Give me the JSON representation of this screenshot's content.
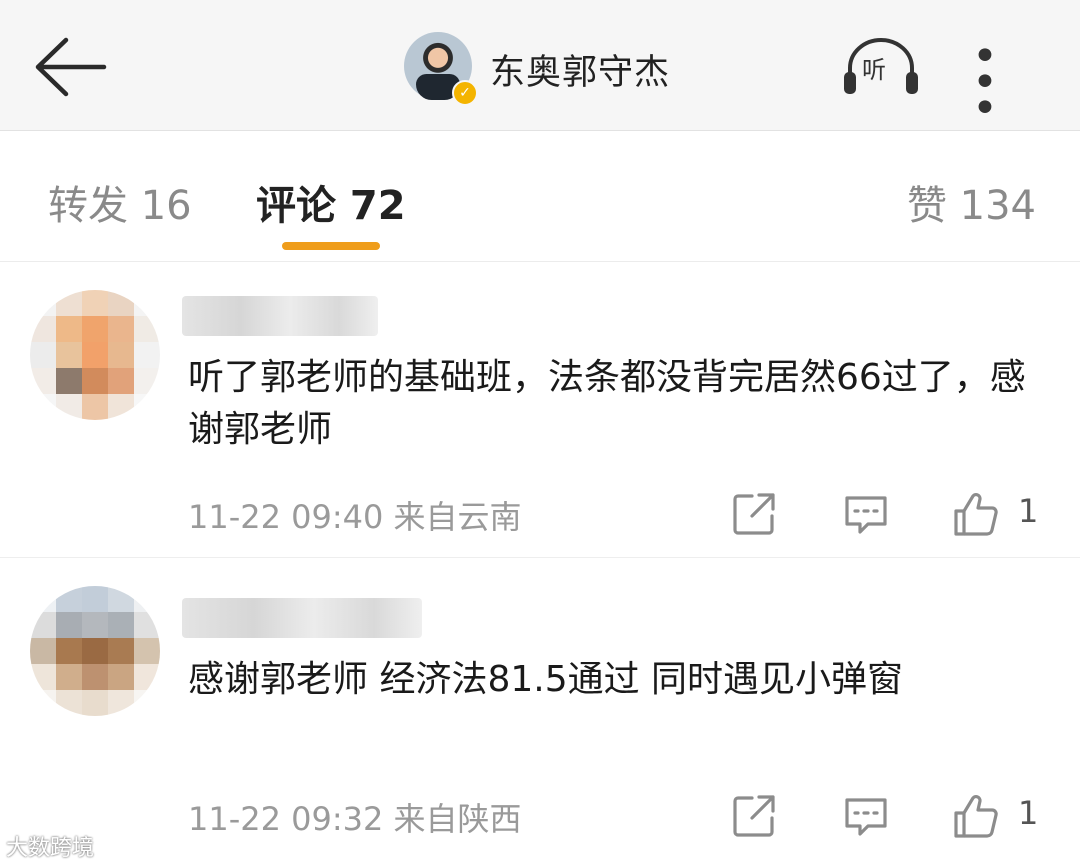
{
  "header": {
    "title": "东奥郭守杰",
    "listen_label": "听",
    "more_label": "• • •"
  },
  "tabs": {
    "repost": "转发 16",
    "comment": "评论 72",
    "like": "赞 134"
  },
  "colors": {
    "accent": "#ef9d1b",
    "verified": "#f4b400"
  },
  "comments": [
    {
      "text": "听了郭老师的基础班，法条都没背完居然66过了，感谢郭老师",
      "meta": "11-22 09:40  来自云南",
      "likes": "1",
      "avatar_colors": [
        "#f3f3f3",
        "#eedfd2",
        "#f0d2b6",
        "#e9d4c2",
        "#f4f4f4",
        "#efe6df",
        "#eeb988",
        "#f0a46c",
        "#eab58d",
        "#f0ebe5",
        "#ececec",
        "#e8c39c",
        "#f2a16a",
        "#e7b88f",
        "#f2f2f2",
        "#f2ece7",
        "#8d7a6c",
        "#d28b5c",
        "#e1a27a",
        "#f3f0ed",
        "#f6f6f6",
        "#f1ebe6",
        "#edc6a6",
        "#f0e4d9",
        "#f7f7f7"
      ]
    },
    {
      "text": "感谢郭老师 经济法81.5通过 同时遇见小弹窗",
      "meta": "11-22 09:32  来自陕西",
      "likes": "1",
      "avatar_colors": [
        "#eef1f4",
        "#c6d0db",
        "#c2cdd9",
        "#d0d8e0",
        "#eef0f2",
        "#dcdcdc",
        "#a8adb3",
        "#b4b8bd",
        "#aab0b6",
        "#e0e0e0",
        "#c9b8a4",
        "#a8794f",
        "#9a6a43",
        "#a97b52",
        "#d4c3ae",
        "#eee5da",
        "#d0ae8c",
        "#bd9170",
        "#caa582",
        "#f0e6dc",
        "#f6f3ef",
        "#ece2d6",
        "#e8dccd",
        "#efe6dc",
        "#f7f5f2"
      ]
    }
  ],
  "watermark": "大数跨境",
  "icons": [
    "back-arrow-icon",
    "listen-headphone-icon",
    "verified-icon",
    "share-icon",
    "reply-icon",
    "thumbs-up-icon"
  ]
}
